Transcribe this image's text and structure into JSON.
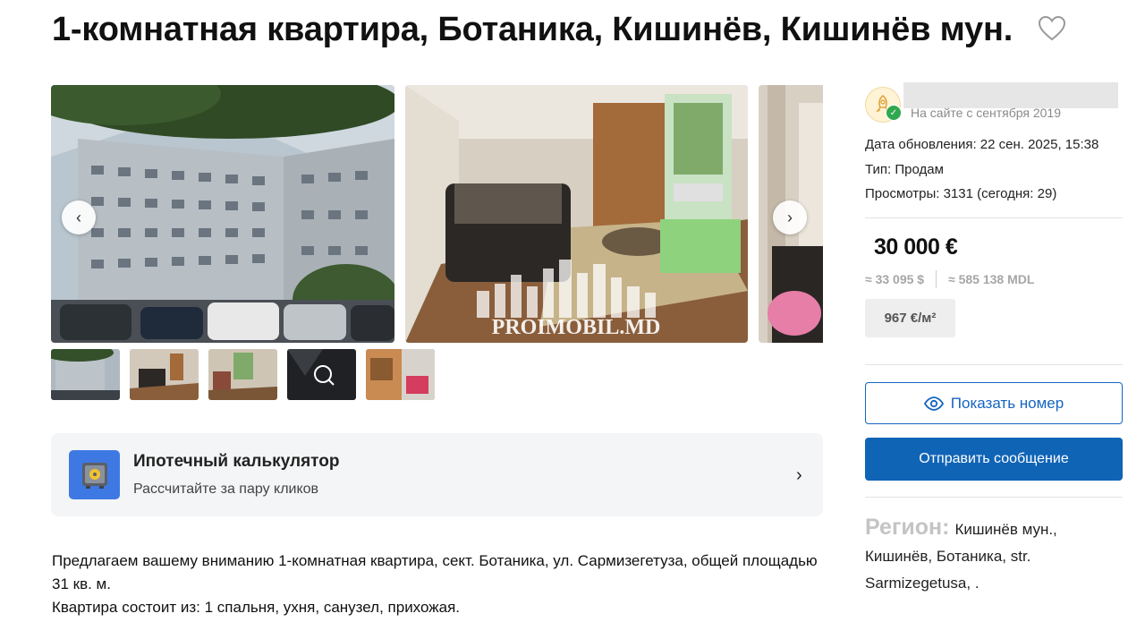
{
  "listing": {
    "title": "1-комнатная квартира, Ботаника, Кишинёв, Кишинёв мун."
  },
  "gallery": {
    "watermark": "PROIMOBIL.MD",
    "prev": "‹",
    "next": "›",
    "thumbnails_count": 5
  },
  "mortgage": {
    "title": "Ипотечный калькулятор",
    "subtitle": "Рассчитайте за пару кликов",
    "chevron": "›"
  },
  "description": {
    "lines": [
      "Предлагаем вашему вниманию 1-комнатная квартира, сект. Ботаника, ул. Сармизегетуза, общей площадью 31 кв. м.",
      "Квартира состоит из: 1 спальня, ухня, санузел, прихожая."
    ]
  },
  "seller": {
    "since": "На сайте с сентября 2019"
  },
  "meta": {
    "updated": "Дата обновления: 22 сен. 2025, 15:38",
    "type": "Тип: Продам",
    "views": "Просмотры: 3131 (сегодня: 29)"
  },
  "price": {
    "main": "30 000 €",
    "usd": "≈ 33 095 $",
    "mdl": "≈ 585 138 MDL",
    "per_m2": "967 €/м²"
  },
  "actions": {
    "show_phone": "Показать номер",
    "send_message": "Отправить сообщение"
  },
  "region": {
    "label": "Регион:",
    "value": "Кишинёв мун., Кишинёв, Ботаника, str. Sarmizegetusa, ."
  },
  "colors": {
    "primary_blue": "#1064b6",
    "outline_blue": "#1565c0",
    "verified_green": "#2fa84f",
    "mortgage_icon_bg": "#3e79e3"
  }
}
